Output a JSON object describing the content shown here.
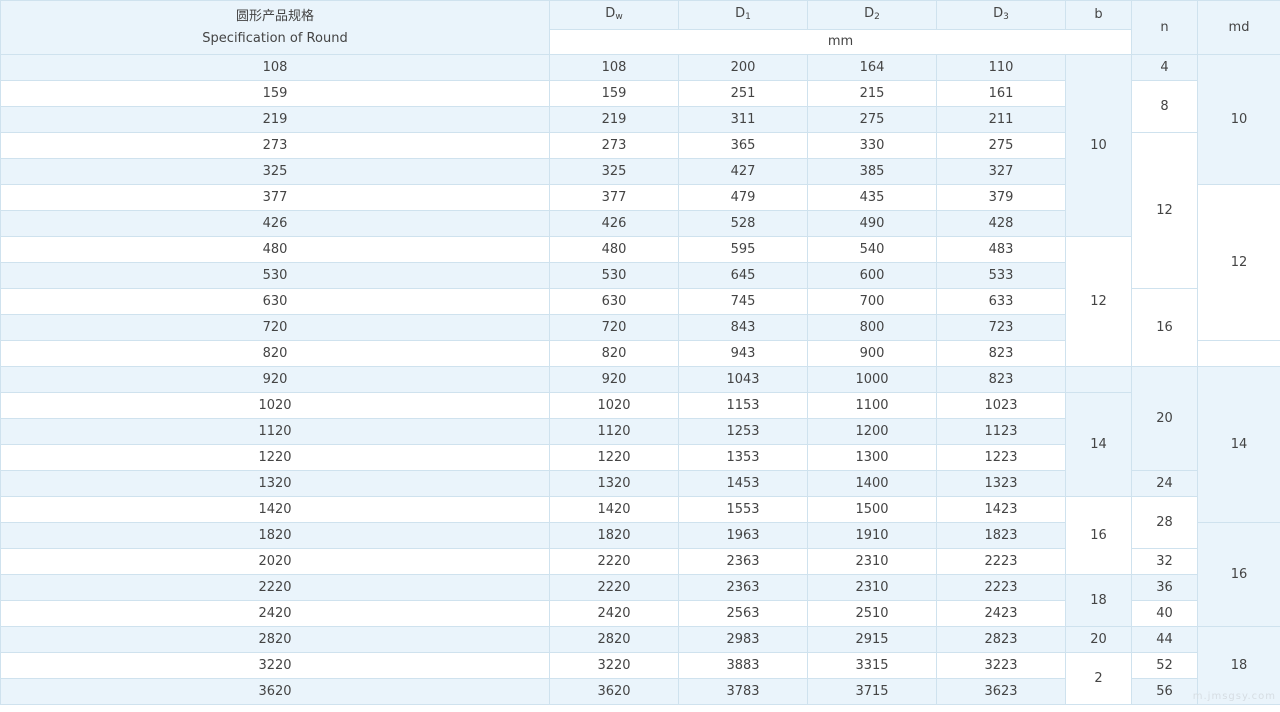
{
  "header": {
    "spec_cn": "圆形产品规格",
    "spec_en": "Specification of Round",
    "dw_base": "D",
    "dw_sub": "w",
    "d1_base": "D",
    "d1_sub": "1",
    "d2_base": "D",
    "d2_sub": "2",
    "d3_base": "D",
    "d3_sub": "3",
    "b": "b",
    "unit": "mm",
    "n": "n",
    "md": "md"
  },
  "rows": [
    {
      "spec": "108",
      "dw": "108",
      "d1": "200",
      "d2": "164",
      "d3": "110"
    },
    {
      "spec": "159",
      "dw": "159",
      "d1": "251",
      "d2": "215",
      "d3": "161"
    },
    {
      "spec": "219",
      "dw": "219",
      "d1": "311",
      "d2": "275",
      "d3": "211"
    },
    {
      "spec": "273",
      "dw": "273",
      "d1": "365",
      "d2": "330",
      "d3": "275"
    },
    {
      "spec": "325",
      "dw": "325",
      "d1": "427",
      "d2": "385",
      "d3": "327"
    },
    {
      "spec": "377",
      "dw": "377",
      "d1": "479",
      "d2": "435",
      "d3": "379"
    },
    {
      "spec": "426",
      "dw": "426",
      "d1": "528",
      "d2": "490",
      "d3": "428"
    },
    {
      "spec": "480",
      "dw": "480",
      "d1": "595",
      "d2": "540",
      "d3": "483"
    },
    {
      "spec": "530",
      "dw": "530",
      "d1": "645",
      "d2": "600",
      "d3": "533"
    },
    {
      "spec": "630",
      "dw": "630",
      "d1": "745",
      "d2": "700",
      "d3": "633"
    },
    {
      "spec": "720",
      "dw": "720",
      "d1": "843",
      "d2": "800",
      "d3": "723"
    },
    {
      "spec": "820",
      "dw": "820",
      "d1": "943",
      "d2": "900",
      "d3": "823"
    },
    {
      "spec": "920",
      "dw": "920",
      "d1": "1043",
      "d2": "1000",
      "d3": "823"
    },
    {
      "spec": "1020",
      "dw": "1020",
      "d1": "1153",
      "d2": "1100",
      "d3": "1023"
    },
    {
      "spec": "1120",
      "dw": "1120",
      "d1": "1253",
      "d2": "1200",
      "d3": "1123"
    },
    {
      "spec": "1220",
      "dw": "1220",
      "d1": "1353",
      "d2": "1300",
      "d3": "1223"
    },
    {
      "spec": "1320",
      "dw": "1320",
      "d1": "1453",
      "d2": "1400",
      "d3": "1323"
    },
    {
      "spec": "1420",
      "dw": "1420",
      "d1": "1553",
      "d2": "1500",
      "d3": "1423"
    },
    {
      "spec": "1820",
      "dw": "1820",
      "d1": "1963",
      "d2": "1910",
      "d3": "1823"
    },
    {
      "spec": "2020",
      "dw": "2220",
      "d1": "2363",
      "d2": "2310",
      "d3": "2223"
    },
    {
      "spec": "2220",
      "dw": "2220",
      "d1": "2363",
      "d2": "2310",
      "d3": "2223"
    },
    {
      "spec": "2420",
      "dw": "2420",
      "d1": "2563",
      "d2": "2510",
      "d3": "2423"
    },
    {
      "spec": "2820",
      "dw": "2820",
      "d1": "2983",
      "d2": "2915",
      "d3": "2823"
    },
    {
      "spec": "3220",
      "dw": "3220",
      "d1": "3883",
      "d2": "3315",
      "d3": "3223"
    },
    {
      "spec": "3620",
      "dw": "3620",
      "d1": "3783",
      "d2": "3715",
      "d3": "3623"
    }
  ],
  "b_groups": [
    {
      "value": "10"
    },
    {
      "value": "12"
    },
    {
      "value": ""
    },
    {
      "value": "14"
    },
    {
      "value": "16"
    },
    {
      "value": "18"
    },
    {
      "value": "20"
    },
    {
      "value": "2"
    }
  ],
  "n_groups": [
    {
      "value": "4"
    },
    {
      "value": "8"
    },
    {
      "value": "12"
    },
    {
      "value": "16"
    },
    {
      "value": "20"
    },
    {
      "value": "24"
    },
    {
      "value": "28"
    },
    {
      "value": "32"
    },
    {
      "value": "36"
    },
    {
      "value": "40"
    },
    {
      "value": "44"
    },
    {
      "value": "52"
    },
    {
      "value": "56"
    }
  ],
  "md_groups": [
    {
      "value": "10"
    },
    {
      "value": "12"
    },
    {
      "value": ""
    },
    {
      "value": "14"
    },
    {
      "value": "16"
    },
    {
      "value": "18"
    }
  ],
  "watermark": "m.jmsgsy.com",
  "colors": {
    "shade": "#eaf4fb",
    "border": "#cfe2ee",
    "text": "#444444"
  }
}
